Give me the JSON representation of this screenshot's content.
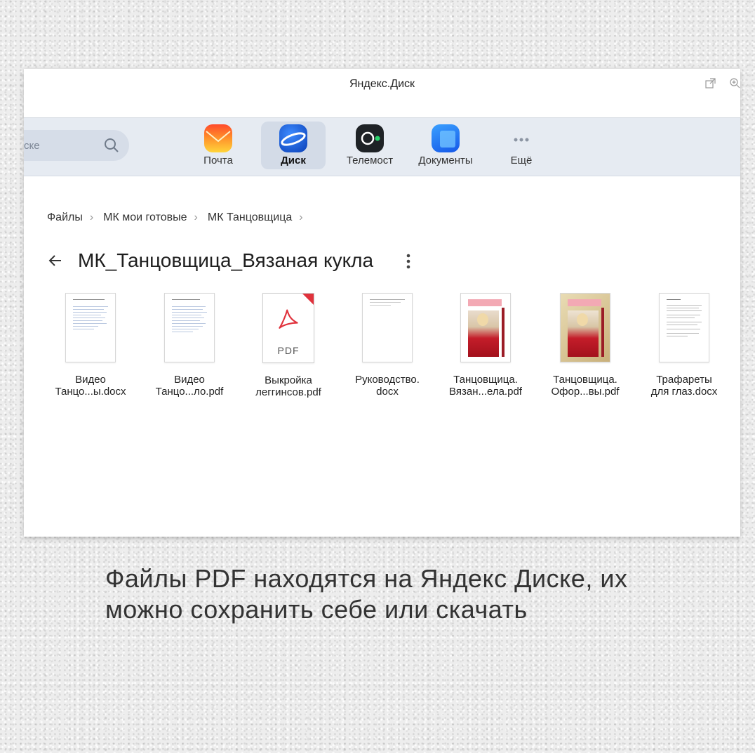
{
  "window": {
    "title": "Яндекс.Диск"
  },
  "appbar": {
    "search_placeholder": "ске",
    "apps": [
      {
        "label": "Почта",
        "icon": "mail-icon",
        "active": false
      },
      {
        "label": "Диск",
        "icon": "disk-icon",
        "active": true
      },
      {
        "label": "Телемост",
        "icon": "telemost-icon",
        "active": false
      },
      {
        "label": "Документы",
        "icon": "documents-icon",
        "active": false
      },
      {
        "label": "Ещё",
        "icon": "more-dots-icon",
        "active": false
      }
    ]
  },
  "breadcrumb": [
    "Файлы",
    "МК мои готовые",
    "МК Танцовщица"
  ],
  "folder": {
    "title": "МК_Танцовщица_Вязаная кукла"
  },
  "files": [
    {
      "line1": "Видео",
      "line2": "Танцо...ы.docx",
      "kind": "doc"
    },
    {
      "line1": "Видео",
      "line2": "Танцо...ло.pdf",
      "kind": "doc"
    },
    {
      "line1": "Выкройка",
      "line2": "леггинсов.pdf",
      "kind": "pdf",
      "badge": "PDF"
    },
    {
      "line1": "Руководство.",
      "line2": "docx",
      "kind": "blank"
    },
    {
      "line1": "Танцовщица.",
      "line2": "Вязан...ела.pdf",
      "kind": "photo"
    },
    {
      "line1": "Танцовщица.",
      "line2": "Офор...вы.pdf",
      "kind": "photo-gold"
    },
    {
      "line1": "Трафареты",
      "line2": "для глаз.docx",
      "kind": "text"
    }
  ],
  "caption": "Файлы PDF находятся на Яндекс Диске, их можно сохранить себе или скачать",
  "colors": {
    "accent": "#1a6ff5",
    "pdf_red": "#e0323c"
  }
}
